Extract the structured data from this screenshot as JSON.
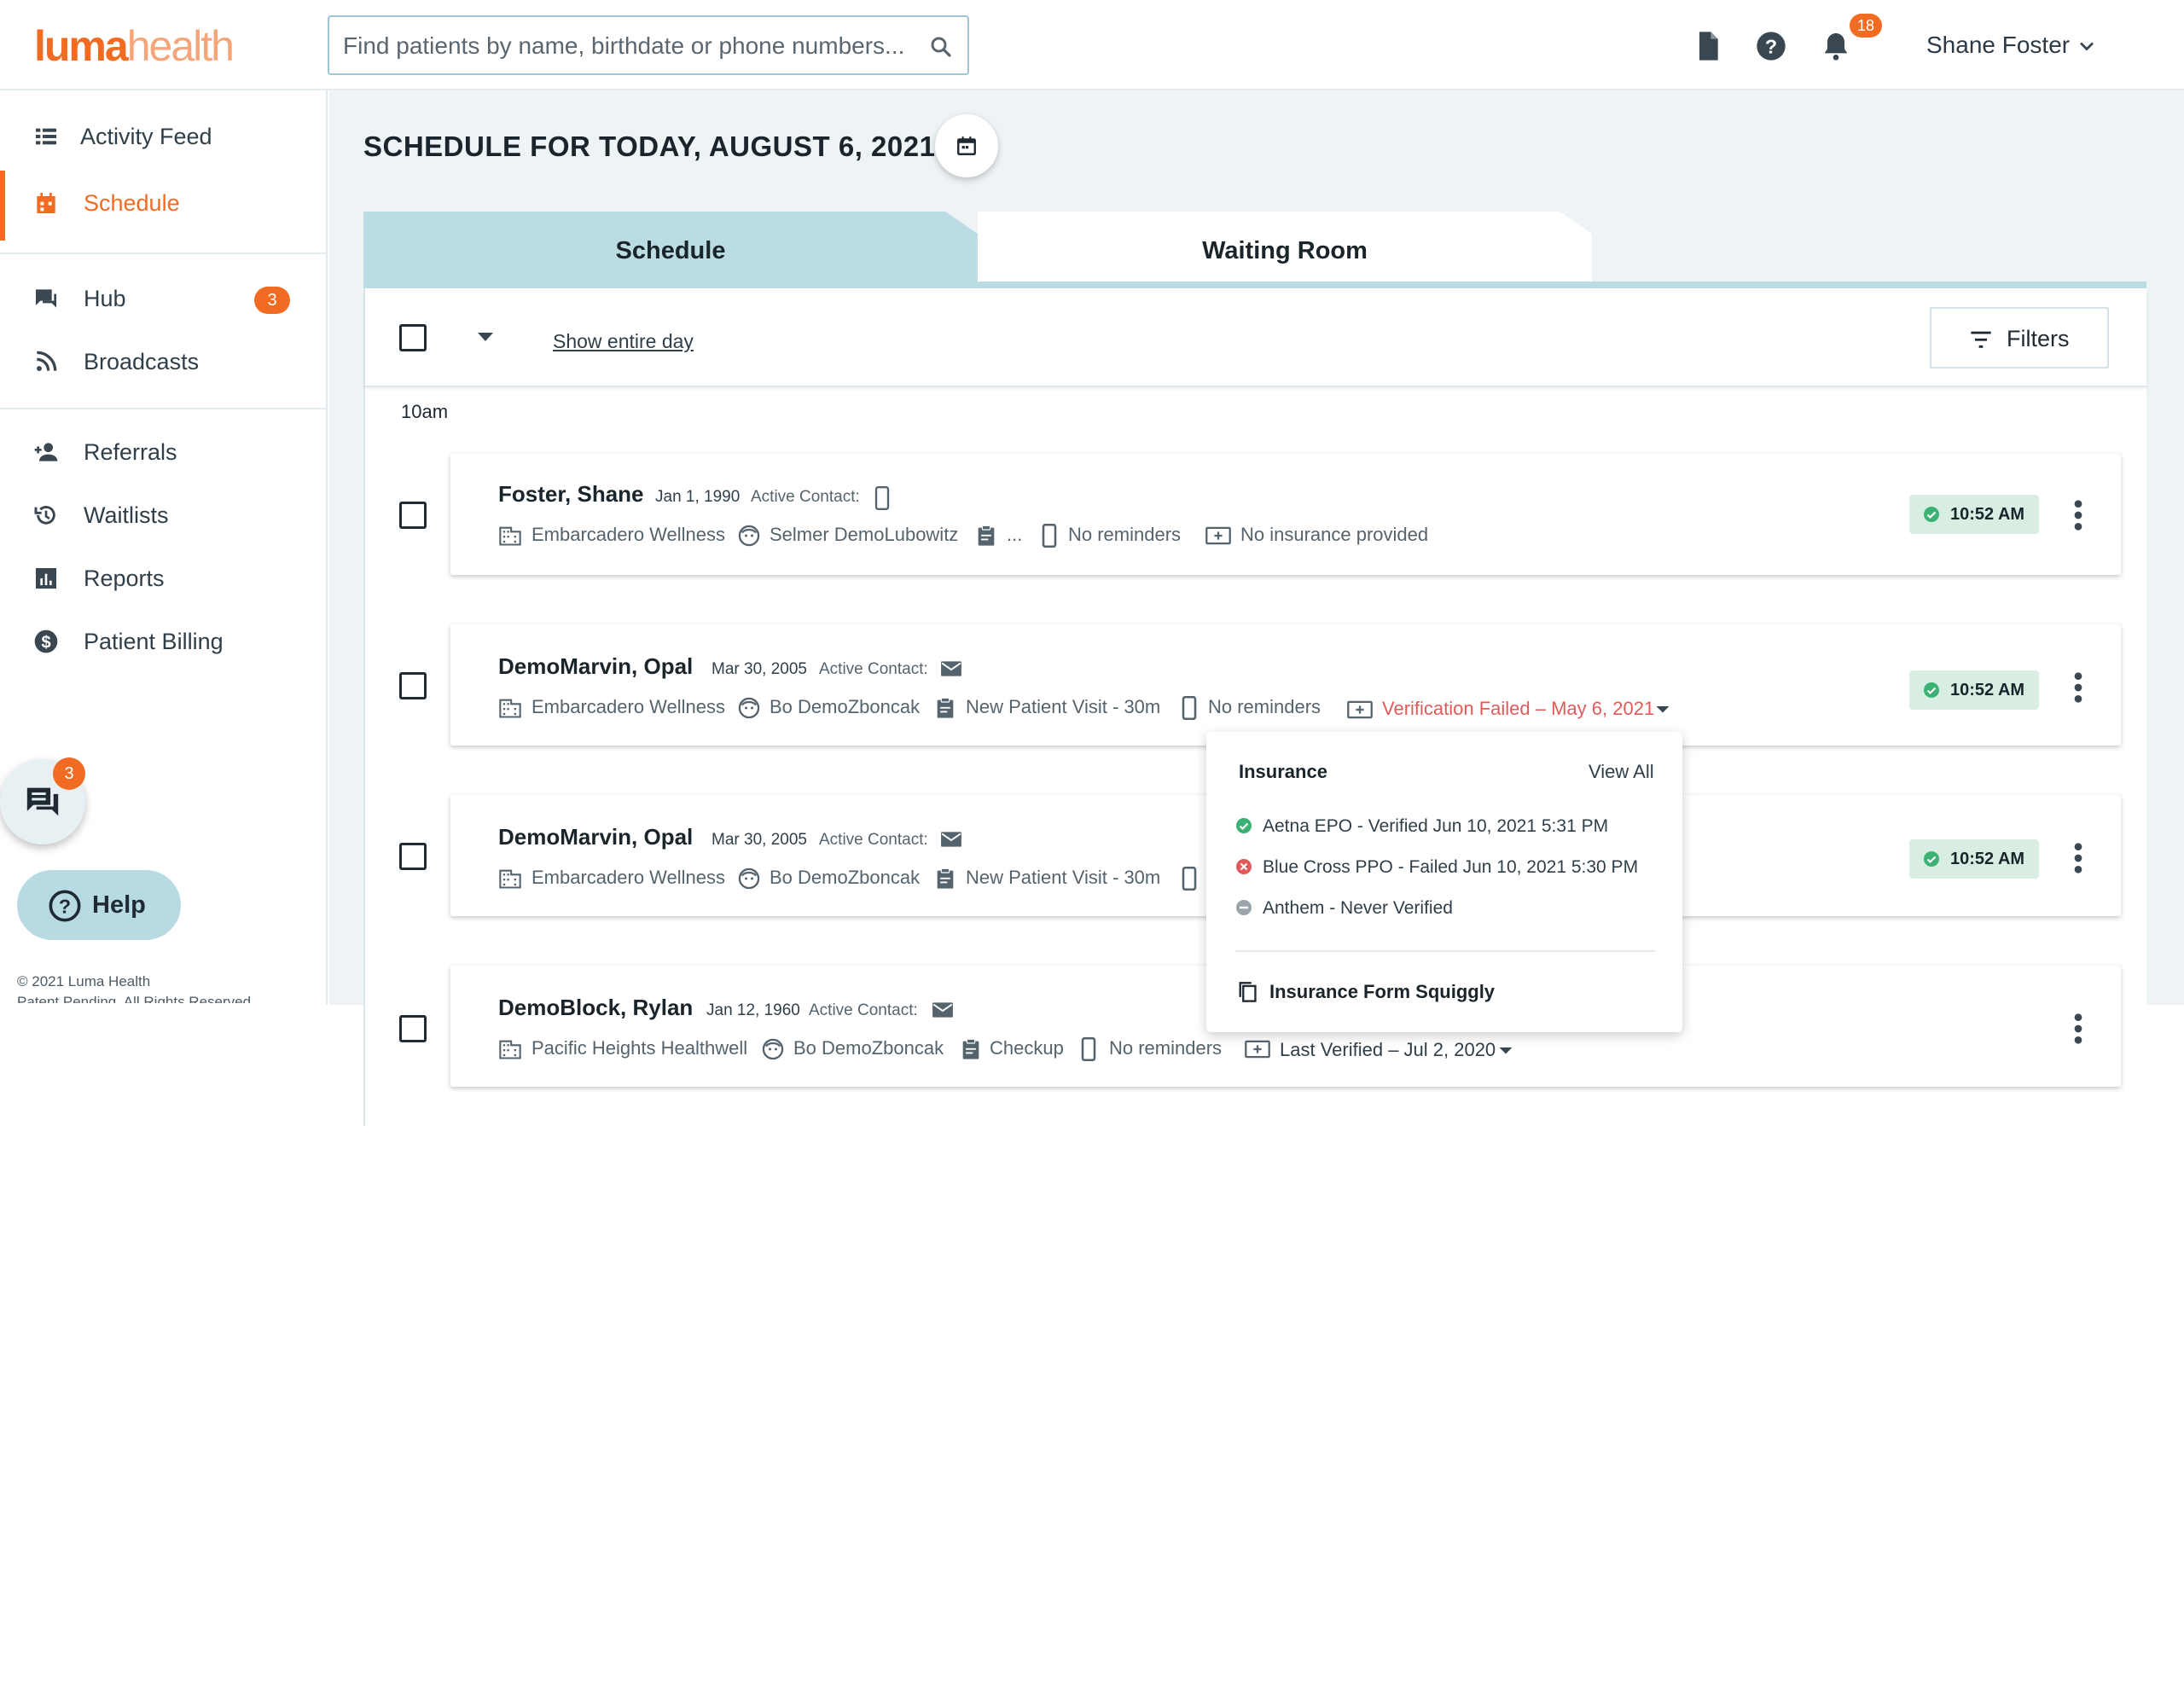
{
  "brand": {
    "logo_part1": "luma",
    "logo_part2": "health",
    "accent": "#f26b22"
  },
  "search": {
    "placeholder": "Find patients by name, birthdate or phone numbers..."
  },
  "topbar": {
    "notifications_count": "18",
    "user_name": "Shane Foster"
  },
  "sidebar": {
    "items": [
      {
        "label": "Activity Feed",
        "icon": "list-icon"
      },
      {
        "label": "Schedule",
        "icon": "calendar-icon",
        "active": true
      },
      {
        "label": "Hub",
        "icon": "chat-icon",
        "badge": "3"
      },
      {
        "label": "Broadcasts",
        "icon": "rss-icon"
      },
      {
        "label": "Referrals",
        "icon": "add-person-icon"
      },
      {
        "label": "Waitlists",
        "icon": "history-icon"
      },
      {
        "label": "Reports",
        "icon": "bar-chart-icon"
      },
      {
        "label": "Patient Billing",
        "icon": "dollar-icon"
      }
    ],
    "chat_badge": "3",
    "help_label": "Help",
    "copyright": "© 2021 Luma Health",
    "copyright_line2": "Patent Pending. All Rights Reserved."
  },
  "page": {
    "title": "SCHEDULE FOR TODAY, AUGUST 6, 2021",
    "tabs": [
      {
        "label": "Schedule"
      },
      {
        "label": "Waiting Room"
      }
    ],
    "show_entire_day": "Show entire day",
    "filters_label": "Filters",
    "time_group": "10am"
  },
  "appointments": [
    {
      "name": "Foster, Shane",
      "dob": "Jan 1, 1990",
      "active_contact": "Active Contact:",
      "facility": "Embarcadero Wellness",
      "provider": "Selmer DemoLubowitz",
      "visit": "...",
      "reminders": "No reminders",
      "insurance": "No insurance provided",
      "time": "10:52 AM"
    },
    {
      "name": "DemoMarvin, Opal",
      "dob": "Mar 30, 2005",
      "active_contact": "Active Contact:",
      "facility": "Embarcadero Wellness",
      "provider": "Bo DemoZboncak",
      "visit": "New Patient Visit - 30m",
      "reminders": "No reminders",
      "insurance": "Verification Failed – May 6, 2021",
      "time": "10:52 AM"
    },
    {
      "name": "DemoMarvin, Opal",
      "dob": "Mar 30, 2005",
      "active_contact": "Active Contact:",
      "facility": "Embarcadero Wellness",
      "provider": "Bo DemoZboncak",
      "visit": "New Patient Visit - 30m",
      "time": "10:52 AM"
    },
    {
      "name": "DemoBlock, Rylan",
      "dob": "Jan 12, 1960",
      "active_contact": "Active Contact:",
      "facility": "Pacific Heights Healthwell",
      "provider": "Bo DemoZboncak",
      "visit": "Checkup",
      "reminders": "No reminders",
      "insurance": "Last Verified – Jul 2, 2020"
    }
  ],
  "insurance_popover": {
    "title": "Insurance",
    "view_all": "View All",
    "items": [
      {
        "text": "Aetna EPO - Verified Jun 10, 2021 5:31 PM",
        "status": "verified",
        "color": "#3bb273"
      },
      {
        "text": "Blue Cross PPO - Failed Jun 10, 2021 5:30 PM",
        "status": "failed",
        "color": "#e05a5a"
      },
      {
        "text": "Anthem - Never Verified",
        "status": "never",
        "color": "#9aa5ab"
      }
    ],
    "form_link": "Insurance Form Squiggly"
  }
}
